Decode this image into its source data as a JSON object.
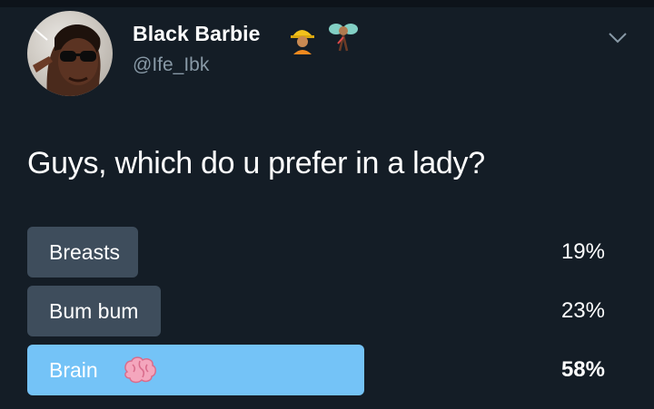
{
  "tweet": {
    "author": {
      "display_name": "Black Barbie",
      "handle": "@Ife_Ibk",
      "name_emoji_icons": [
        "construction-worker-icon",
        "fairy-icon"
      ]
    },
    "text": "Guys, which do u prefer in a lady?",
    "poll": {
      "options": [
        {
          "label": "Breasts",
          "percent": "19%",
          "value": 19,
          "leading": false
        },
        {
          "label": "Bum bum",
          "percent": "23%",
          "value": 23,
          "leading": false
        },
        {
          "label": "Brain",
          "percent": "58%",
          "value": 58,
          "leading": true,
          "icon": "brain-icon"
        }
      ]
    }
  },
  "colors": {
    "background": "#141d26",
    "text": "#ffffff",
    "secondary_text": "#8899a6",
    "poll_bar": "#3e4d5c",
    "poll_bar_leading": "#74c3f7"
  }
}
